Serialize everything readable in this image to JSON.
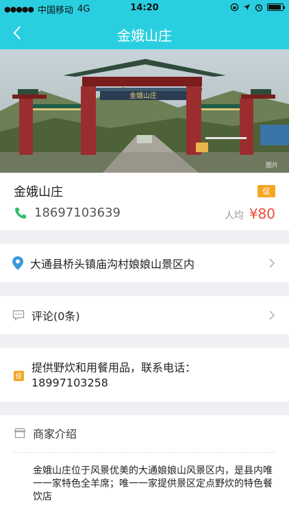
{
  "status_bar": {
    "signal": "●●●●●",
    "carrier": "中国移动",
    "network": "4G",
    "time": "14:20"
  },
  "nav": {
    "title": "金娥山庄"
  },
  "hero": {
    "sign_text": "金娥山庄",
    "watermark": "图片"
  },
  "shop": {
    "name": "金娥山庄",
    "promo_tag": "促",
    "phone": "18697103639",
    "avg_label": "人均",
    "avg_price": "¥80"
  },
  "address": {
    "text": "大通县桥头镇庙沟村娘娘山景区内"
  },
  "comments": {
    "text": "评论(0条)"
  },
  "promotion": {
    "tag": "促",
    "line1": "提供野炊和用餐用品，联系电话：",
    "line2": "18997103258"
  },
  "intro": {
    "title": "商家介绍",
    "text": "金娥山庄位于风景优美的大通娘娘山风景区内，是县内唯一一家特色全羊席；唯一一家提供景区定点野炊的特色餐饮店"
  },
  "colors": {
    "accent": "#29cfe0",
    "price": "#f04a3a",
    "promo": "#f5a623",
    "phone_icon": "#2ebd6b",
    "location_icon": "#3a9ad9"
  }
}
